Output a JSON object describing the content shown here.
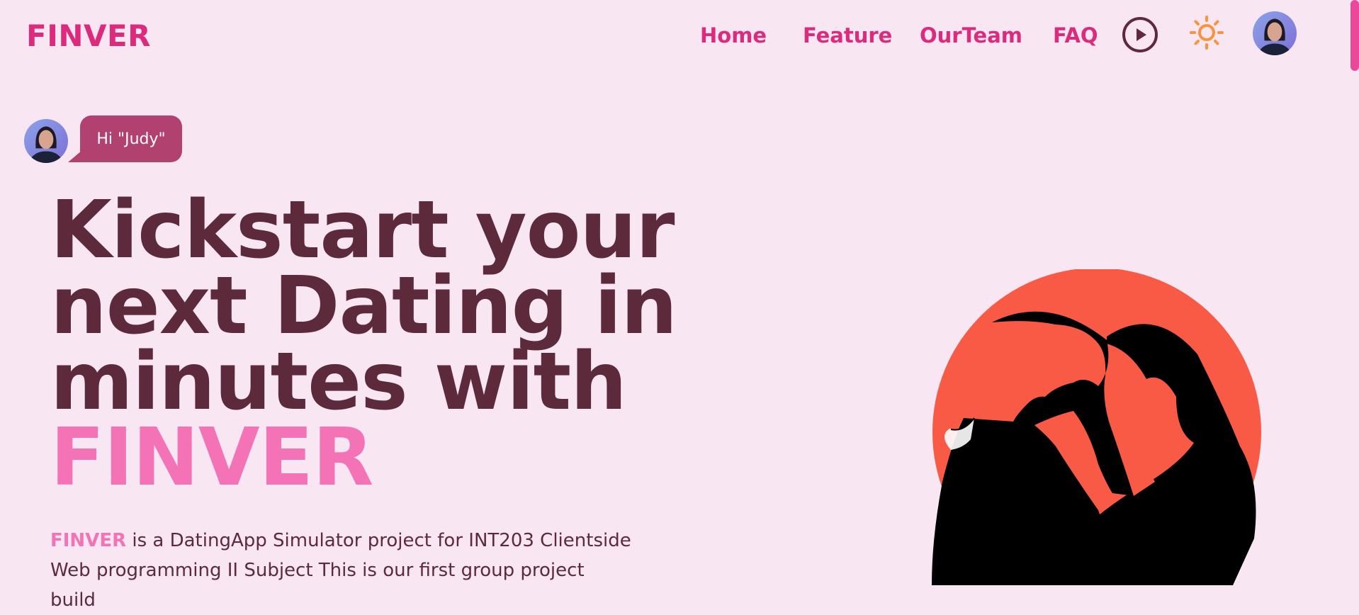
{
  "header": {
    "logo": "FINVER",
    "nav": [
      {
        "label": "Home"
      },
      {
        "label": "Feature"
      },
      {
        "label": "OurTeam"
      },
      {
        "label": "FAQ"
      }
    ],
    "icons": [
      "play-icon",
      "sun-icon",
      "user-avatar"
    ]
  },
  "hero": {
    "greeting": "Hi \"Judy\"",
    "headline_lines": [
      "Kickstart your",
      "next Dating in",
      "minutes with"
    ],
    "brand_word": "FINVER",
    "description_brand": "FINVER",
    "description_rest": " is a DatingApp Simulator project for INT203 Clientside Web programming II Subject This is our first group project build"
  },
  "colors": {
    "background": "#f9e6f3",
    "accent": "#dc2b7d",
    "headline": "#5d2a3b",
    "brand_pink": "#f472b6",
    "bubble": "#b1416f",
    "sun": "#fb923c",
    "illustration_circle": "#f95a45"
  }
}
